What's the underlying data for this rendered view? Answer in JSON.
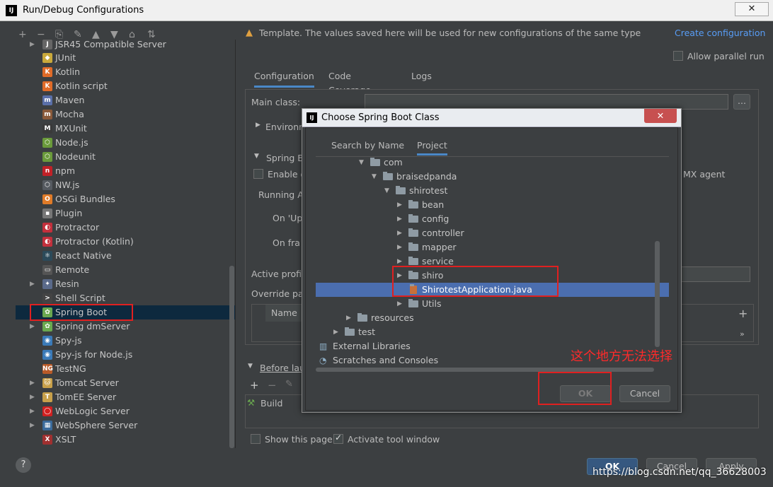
{
  "window": {
    "title": "Run/Debug Configurations",
    "close": "✕"
  },
  "left_toolbar": [
    "+",
    "−",
    "⎘",
    "✎",
    "▲",
    "▼",
    "⌂",
    "⇅"
  ],
  "tree": {
    "partial_top": "JSR45 Compatible Server",
    "items": [
      {
        "label": "JUnit",
        "icon": "junit-icon",
        "color": "#c9a93b",
        "text": "◆",
        "arrow": ""
      },
      {
        "label": "Kotlin",
        "icon": "kotlin-icon",
        "color": "#e06b28",
        "text": "K",
        "arrow": ""
      },
      {
        "label": "Kotlin script",
        "icon": "kotlin-script-icon",
        "color": "#e06b28",
        "text": "K",
        "arrow": ""
      },
      {
        "label": "Maven",
        "icon": "maven-icon",
        "color": "#5a6fa8",
        "text": "m",
        "arrow": ""
      },
      {
        "label": "Mocha",
        "icon": "mocha-icon",
        "color": "#8a5a3a",
        "text": "m",
        "arrow": ""
      },
      {
        "label": "MXUnit",
        "icon": "mxunit-icon",
        "color": "#3a3a3a",
        "text": "M",
        "arrow": ""
      },
      {
        "label": "Node.js",
        "icon": "nodejs-icon",
        "color": "#6a9a3a",
        "text": "⬡",
        "arrow": ""
      },
      {
        "label": "Nodeunit",
        "icon": "nodeunit-icon",
        "color": "#6a9a3a",
        "text": "⬡",
        "arrow": ""
      },
      {
        "label": "npm",
        "icon": "npm-icon",
        "color": "#c12127",
        "text": "n",
        "arrow": ""
      },
      {
        "label": "NW.js",
        "icon": "nwjs-icon",
        "color": "#555a60",
        "text": "⬡",
        "arrow": ""
      },
      {
        "label": "OSGi Bundles",
        "icon": "osgi-icon",
        "color": "#e07b28",
        "text": "O",
        "arrow": ""
      },
      {
        "label": "Plugin",
        "icon": "plugin-icon",
        "color": "#777",
        "text": "▪",
        "arrow": ""
      },
      {
        "label": "Protractor",
        "icon": "protractor-icon",
        "color": "#c3303c",
        "text": "◐",
        "arrow": ""
      },
      {
        "label": "Protractor (Kotlin)",
        "icon": "protractor-kotlin-icon",
        "color": "#c3303c",
        "text": "◐",
        "arrow": ""
      },
      {
        "label": "React Native",
        "icon": "react-icon",
        "color": "#2b4a5a",
        "text": "⚛",
        "arrow": ""
      },
      {
        "label": "Remote",
        "icon": "remote-icon",
        "color": "#555",
        "text": "▭",
        "arrow": ""
      },
      {
        "label": "Resin",
        "icon": "resin-icon",
        "color": "#5a6a8a",
        "text": "✦",
        "arrow": "▶"
      },
      {
        "label": "Shell Script",
        "icon": "shell-script-icon",
        "color": "#444",
        "text": ">",
        "arrow": ""
      },
      {
        "label": "Spring Boot",
        "icon": "spring-boot-icon",
        "color": "#6aa84f",
        "text": "✿",
        "arrow": ""
      },
      {
        "label": "Spring dmServer",
        "icon": "spring-dmserver-icon",
        "color": "#6aa84f",
        "text": "✿",
        "arrow": "▶"
      },
      {
        "label": "Spy-js",
        "icon": "spyjs-icon",
        "color": "#3a7ab8",
        "text": "◉",
        "arrow": ""
      },
      {
        "label": "Spy-js for Node.js",
        "icon": "spyjs-node-icon",
        "color": "#3a7ab8",
        "text": "◉",
        "arrow": ""
      },
      {
        "label": "TestNG",
        "icon": "testng-icon",
        "color": "#b85a28",
        "text": "NG",
        "arrow": ""
      },
      {
        "label": "Tomcat Server",
        "icon": "tomcat-icon",
        "color": "#c8a04a",
        "text": "🐱",
        "arrow": "▶"
      },
      {
        "label": "TomEE Server",
        "icon": "tomee-icon",
        "color": "#c8a04a",
        "text": "T",
        "arrow": "▶"
      },
      {
        "label": "WebLogic Server",
        "icon": "weblogic-icon",
        "color": "#d02020",
        "text": "◯",
        "arrow": "▶"
      },
      {
        "label": "WebSphere Server",
        "icon": "websphere-icon",
        "color": "#3a6a9a",
        "text": "▦",
        "arrow": "▶"
      },
      {
        "label": "XSLT",
        "icon": "xslt-icon",
        "color": "#a03030",
        "text": "X",
        "arrow": ""
      }
    ]
  },
  "template_warning": "Template. The values saved here will be used for new configurations of the same type",
  "create_configuration": "Create configuration",
  "allow_parallel": "Allow parallel run",
  "tabs": [
    "Configuration",
    "Code Coverage",
    "Logs"
  ],
  "config": {
    "main_class": "Main class:",
    "browse": "...",
    "environment": "Environm",
    "spring": "Spring B",
    "enable": "Enable d",
    "jmx_agent": "MX agent",
    "running": "Running A",
    "on_update": "On 'Up",
    "on_frame": "On fra",
    "active_profiles": "Active profil",
    "override": "Override pa",
    "name_col": "Name",
    "plus": "+",
    "more": "»"
  },
  "before_launch": {
    "label": "Before lau",
    "item": "Build"
  },
  "footer": {
    "show_page": "Show this page",
    "activate_tool": "Activate tool window",
    "ok": "OK",
    "cancel": "Cancel",
    "apply": "Apply",
    "help": "?"
  },
  "watermark": "https://blog.csdn.net/qq_36628003",
  "dialog": {
    "title": "Choose Spring Boot Class",
    "close": "✕",
    "tabs": [
      "Search by Name",
      "Project"
    ],
    "rows": [
      {
        "label": "com",
        "indent": 0,
        "arrow": "▼",
        "kind": "folder"
      },
      {
        "label": "braisedpanda",
        "indent": 1,
        "arrow": "▼",
        "kind": "folder"
      },
      {
        "label": "shirotest",
        "indent": 2,
        "arrow": "▼",
        "kind": "folder"
      },
      {
        "label": "bean",
        "indent": 3,
        "arrow": "▶",
        "kind": "folder"
      },
      {
        "label": "config",
        "indent": 3,
        "arrow": "▶",
        "kind": "folder"
      },
      {
        "label": "controller",
        "indent": 3,
        "arrow": "▶",
        "kind": "folder"
      },
      {
        "label": "mapper",
        "indent": 3,
        "arrow": "▶",
        "kind": "folder"
      },
      {
        "label": "service",
        "indent": 3,
        "arrow": "▶",
        "kind": "folder"
      },
      {
        "label": "shiro",
        "indent": 3,
        "arrow": "▶",
        "kind": "folder"
      },
      {
        "label": "ShirotestApplication.java",
        "indent": 3,
        "arrow": "",
        "kind": "java",
        "selected": true
      },
      {
        "label": "Utils",
        "indent": 3,
        "arrow": "▶",
        "kind": "folder"
      },
      {
        "label": "resources",
        "indent": -1,
        "arrow": "▶",
        "kind": "folder"
      },
      {
        "label": "test",
        "indent": -2,
        "arrow": "▶",
        "kind": "folder"
      },
      {
        "label": "External Libraries",
        "indent": -4,
        "arrow": "▶",
        "kind": "libs"
      },
      {
        "label": "Scratches and Consoles",
        "indent": -4,
        "arrow": "▶",
        "kind": "scratch"
      }
    ],
    "ok": "OK",
    "cancel": "Cancel"
  },
  "annotation": "这个地方无法选择"
}
